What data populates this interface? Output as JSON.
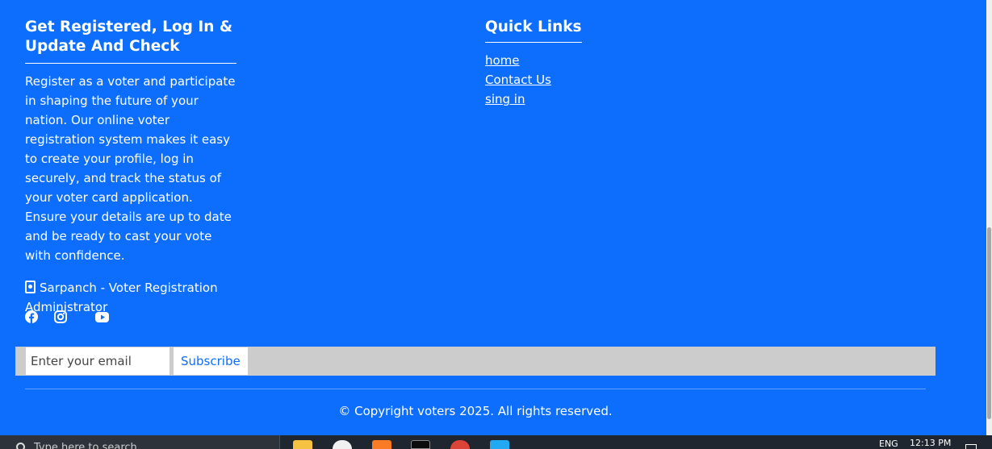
{
  "about": {
    "heading": "Get Registered, Log In & Update And Check",
    "description": "Register as a voter and participate in shaping the future of your nation. Our online voter registration system makes it easy to create your profile, log in securely, and track the status of your voter card application. Ensure your details are up to date and be ready to cast your vote with confidence.",
    "admin": "Sarpanch - Voter Registration Administrator",
    "social": [
      "facebook-icon",
      "instagram-icon",
      "youtube-icon"
    ]
  },
  "quick_links": {
    "heading": "Quick Links",
    "links": [
      "home",
      "Contact Us",
      "sing in"
    ]
  },
  "subscribe": {
    "placeholder": "Enter your email",
    "button": "Subscribe"
  },
  "copyright": "© Copyright voters 2025. All rights reserved.",
  "taskbar": {
    "search_placeholder": "Type here to search",
    "language": "ENG",
    "time": "12:13 PM",
    "apps": [
      "file-explorer-icon",
      "paint-icon",
      "xampp-icon",
      "terminal-icon",
      "chrome-icon",
      "vscode-icon"
    ]
  },
  "colors": {
    "footer_bg": "#0d6efd",
    "subscribe_bar": "#cccccc",
    "taskbar": "#20262f"
  }
}
